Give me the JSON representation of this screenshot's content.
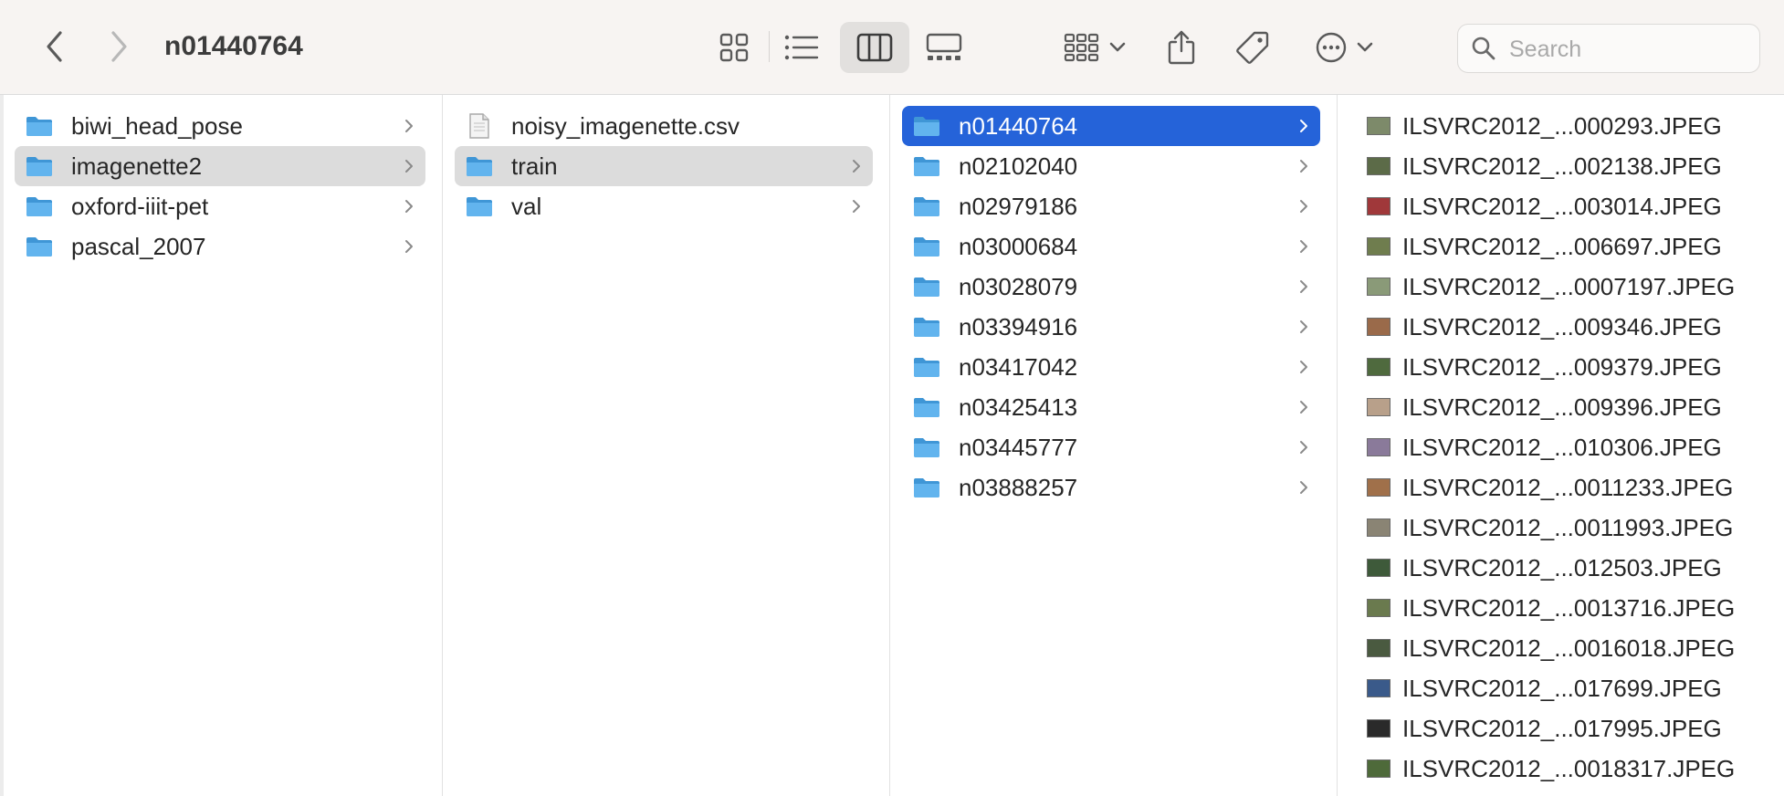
{
  "toolbar": {
    "title": "n01440764",
    "search_placeholder": "Search"
  },
  "columns": {
    "col1": [
      {
        "label": "biwi_head_pose",
        "type": "folder",
        "selected": "none"
      },
      {
        "label": "imagenette2",
        "type": "folder",
        "selected": "gray"
      },
      {
        "label": "oxford-iiit-pet",
        "type": "folder",
        "selected": "none"
      },
      {
        "label": "pascal_2007",
        "type": "folder",
        "selected": "none"
      }
    ],
    "col2": [
      {
        "label": "noisy_imagenette.csv",
        "type": "csv-file",
        "selected": "none"
      },
      {
        "label": "train",
        "type": "folder",
        "selected": "gray"
      },
      {
        "label": "val",
        "type": "folder",
        "selected": "none"
      }
    ],
    "col3": [
      {
        "label": "n01440764",
        "type": "folder",
        "selected": "blue"
      },
      {
        "label": "n02102040",
        "type": "folder",
        "selected": "none"
      },
      {
        "label": "n02979186",
        "type": "folder",
        "selected": "none"
      },
      {
        "label": "n03000684",
        "type": "folder",
        "selected": "none"
      },
      {
        "label": "n03028079",
        "type": "folder",
        "selected": "none"
      },
      {
        "label": "n03394916",
        "type": "folder",
        "selected": "none"
      },
      {
        "label": "n03417042",
        "type": "folder",
        "selected": "none"
      },
      {
        "label": "n03425413",
        "type": "folder",
        "selected": "none"
      },
      {
        "label": "n03445777",
        "type": "folder",
        "selected": "none"
      },
      {
        "label": "n03888257",
        "type": "folder",
        "selected": "none"
      }
    ],
    "col4": [
      {
        "label": "ILSVRC2012_...000293.JPEG",
        "type": "image-file",
        "thumb_color": "#7d8a6a"
      },
      {
        "label": "ILSVRC2012_...002138.JPEG",
        "type": "image-file",
        "thumb_color": "#5c6b48"
      },
      {
        "label": "ILSVRC2012_...003014.JPEG",
        "type": "image-file",
        "thumb_color": "#a0383a"
      },
      {
        "label": "ILSVRC2012_...006697.JPEG",
        "type": "image-file",
        "thumb_color": "#6f7d4e"
      },
      {
        "label": "ILSVRC2012_...0007197.JPEG",
        "type": "image-file",
        "thumb_color": "#8a9a78"
      },
      {
        "label": "ILSVRC2012_...009346.JPEG",
        "type": "image-file",
        "thumb_color": "#9a6a4a"
      },
      {
        "label": "ILSVRC2012_...009379.JPEG",
        "type": "image-file",
        "thumb_color": "#4f6a3e"
      },
      {
        "label": "ILSVRC2012_...009396.JPEG",
        "type": "image-file",
        "thumb_color": "#b8a08a"
      },
      {
        "label": "ILSVRC2012_...010306.JPEG",
        "type": "image-file",
        "thumb_color": "#8a7a9a"
      },
      {
        "label": "ILSVRC2012_...0011233.JPEG",
        "type": "image-file",
        "thumb_color": "#a0704a"
      },
      {
        "label": "ILSVRC2012_...0011993.JPEG",
        "type": "image-file",
        "thumb_color": "#8a8474"
      },
      {
        "label": "ILSVRC2012_...012503.JPEG",
        "type": "image-file",
        "thumb_color": "#3e5a3a"
      },
      {
        "label": "ILSVRC2012_...0013716.JPEG",
        "type": "image-file",
        "thumb_color": "#6a7a4e"
      },
      {
        "label": "ILSVRC2012_...0016018.JPEG",
        "type": "image-file",
        "thumb_color": "#4a5a40"
      },
      {
        "label": "ILSVRC2012_...017699.JPEG",
        "type": "image-file",
        "thumb_color": "#3a5a8a"
      },
      {
        "label": "ILSVRC2012_...017995.JPEG",
        "type": "image-file",
        "thumb_color": "#2a2a2a"
      },
      {
        "label": "ILSVRC2012_...0018317.JPEG",
        "type": "image-file",
        "thumb_color": "#4e6a3a"
      }
    ]
  },
  "colors": {
    "selection_blue": "#2563d9",
    "selection_gray": "#dcdcdc",
    "folder_blue": "#5ab0ea",
    "toolbar_bg": "#f7f4f2"
  }
}
